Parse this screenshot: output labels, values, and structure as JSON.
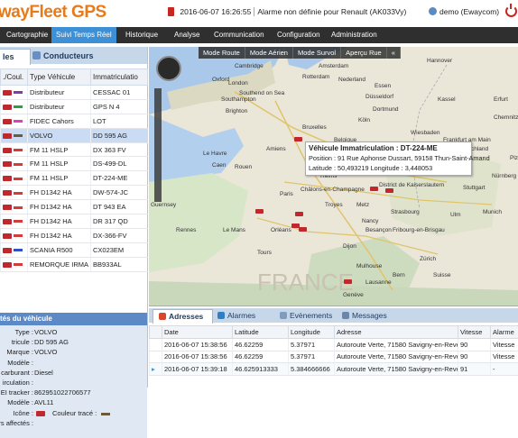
{
  "app": {
    "title": "wayFleet GPS"
  },
  "alarm": {
    "datetime": "2016-06-07 16:26:55",
    "message": "Alarme non définie pour Renault (AK033Vy)"
  },
  "user": {
    "label": "demo (Ewaycom)"
  },
  "menu": [
    "Cartographie",
    "Suivi Temps Réel",
    "Historique",
    "Analyse",
    "Communication",
    "Configuration",
    "Administration"
  ],
  "left_tabs": {
    "vehicles": "les",
    "drivers": "Conducteurs"
  },
  "vehicle_table": {
    "headers": [
      "./Coul.",
      "Type Véhicule",
      "Immatriculatio"
    ],
    "rows": [
      {
        "type": "Distributeur",
        "plate": "CESSAC 01",
        "color": "#7a3fa0"
      },
      {
        "type": "Distributeur",
        "plate": "GPS N 4",
        "color": "#2f9e3e"
      },
      {
        "type": "FIDEC Cahors",
        "plate": "LOT",
        "color": "#e23fb5"
      },
      {
        "type": "VOLVO",
        "plate": "DD 595 AG",
        "color": "#6d5a3c"
      },
      {
        "type": "FM 11 HSLP",
        "plate": "DX 363 FV",
        "color": "#d63b3b"
      },
      {
        "type": "FM 11 HSLP",
        "plate": "DS-499-DL",
        "color": "#d63b3b"
      },
      {
        "type": "FM 11 HSLP",
        "plate": "DT-224-ME",
        "color": "#d63b3b"
      },
      {
        "type": "FH D1342 HA",
        "plate": "DW-574-JC",
        "color": "#d63b3b"
      },
      {
        "type": "FH D1342 HA",
        "plate": "DT 943 EA",
        "color": "#d63b3b"
      },
      {
        "type": "FH D1342 HA",
        "plate": "DR 317 QD",
        "color": "#d63b3b"
      },
      {
        "type": "FH D1342 HA",
        "plate": "DX-366-FV",
        "color": "#d63b3b"
      },
      {
        "type": "SCANIA R500",
        "plate": "CX023EM",
        "color": "#3050c8"
      },
      {
        "type": "REMORQUE IRMA",
        "plate": "BB933AL",
        "color": "#d63b3b"
      }
    ]
  },
  "properties": {
    "title": "tés du véhicule",
    "items": [
      {
        "key": "Type :",
        "value": "VOLVO"
      },
      {
        "key": "tricule :",
        "value": "DD 595 AG"
      },
      {
        "key": "Marque :",
        "value": "VOLVO"
      },
      {
        "key": "Modèle :",
        "value": ""
      },
      {
        "key": "carburant :",
        "value": "Diesel"
      },
      {
        "key": "irculation :",
        "value": ""
      },
      {
        "key": "EI tracker :",
        "value": "862951022706577"
      },
      {
        "key": "Modèle :",
        "value": "AVL11"
      },
      {
        "key": "Icône :",
        "value": "",
        "extra": "Couleur tracé :"
      },
      {
        "key": "rs affectés :",
        "value": ""
      }
    ]
  },
  "map": {
    "toolbar": [
      "Mode Route",
      "Mode Aérien",
      "Mode Survol",
      "Aperçu Rue"
    ],
    "popup": {
      "title": "Véhicule Immatriculation : DT-224-ME",
      "position": "Position : 91 Rue Aphonse Dussart, 59158 Thun-Saint-Amand",
      "coords": "Latitude : 50,493219     Longitude : 3,448053"
    },
    "labels": [
      "Cambridge",
      "Oxford",
      "London",
      "Southend on Sea",
      "Southampton",
      "Brighton",
      "Amsterdam",
      "Rotterdam",
      "Nederland",
      "Essen",
      "Düsseldorf",
      "Dortmund",
      "Köln",
      "Bruxelles",
      "Belgique",
      "Luxembourg",
      "Hannover",
      "Kassel",
      "Erfurt",
      "Frankfurt am Main",
      "Deutschland",
      "Stuttgart",
      "Le Havre",
      "Rouen",
      "Caen",
      "Paris",
      "Reims",
      "Châlons-en-Champagne",
      "Metz",
      "Nancy",
      "District de Kaiserslautern",
      "Mannheim",
      "Nürnberg",
      "Rennes",
      "Le Mans",
      "Orléans",
      "Tours",
      "Dijon",
      "Besançon",
      "Fribourg-en-Brisgau",
      "Munich",
      "Zürich",
      "Suisse",
      "Bern",
      "Lausanne",
      "Genève",
      "Chemnitz",
      "Wiesbaden",
      "Plzeň",
      "Guernsey",
      "Lille",
      "Amiens",
      "Strasbourg",
      "Troyes",
      "Ulm",
      "Mulhouse"
    ]
  },
  "bottom_tabs": [
    "Adresses",
    "Alarmes",
    "Evènements",
    "Messages"
  ],
  "events": {
    "headers": [
      "",
      "Date",
      "Latitude",
      "Longitude",
      "Adresse",
      "Vitesse",
      "Alarme"
    ],
    "rows": [
      {
        "date": "2016-06-07 15:38:56",
        "lat": "46.62259",
        "lon": "5.37971",
        "addr": "Autoroute Verte, 71580 Savigny-en-Reve",
        "speed": "90",
        "alarm": "Vitesse"
      },
      {
        "date": "2016-06-07 15:38:56",
        "lat": "46.62259",
        "lon": "5.37971",
        "addr": "Autoroute Verte, 71580 Savigny-en-Reve",
        "speed": "90",
        "alarm": "Vitesse"
      },
      {
        "date": "2016-06-07 15:39:18",
        "lat": "46.625913333",
        "lon": "5.384666666",
        "addr": "Autoroute Verte, 71580 Savigny-en-Reve",
        "speed": "91",
        "alarm": "-"
      }
    ]
  },
  "colors": {
    "accent": "#3d8fd6",
    "brand": "#e87a17",
    "alarm": "#c8261f",
    "header_bg": "#2f2f2f",
    "vehicle_marker": "#c1272d"
  }
}
